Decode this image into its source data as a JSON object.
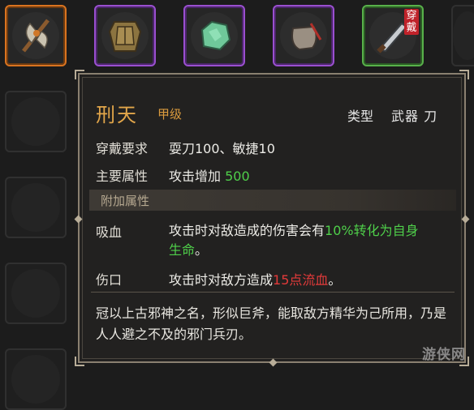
{
  "inventory": {
    "worn_tag": "穿戴",
    "slots_top": [
      {
        "name": "axe",
        "rarity": "orange"
      },
      {
        "name": "armor",
        "rarity": "purple"
      },
      {
        "name": "jade",
        "rarity": "purple"
      },
      {
        "name": "pouch",
        "rarity": "purple"
      },
      {
        "name": "blade",
        "rarity": "green",
        "worn": true
      }
    ]
  },
  "tooltip": {
    "name": "刑天",
    "grade": "甲级",
    "type_label": "类型",
    "type_value": "武器 刀",
    "requirement_label": "穿戴要求",
    "requirement_value": "耍刀100、敏捷10",
    "main_attr_label": "主要属性",
    "main_attr_text": "攻击增加",
    "main_attr_value": "500",
    "extra_section": "附加属性",
    "lifesteal_label": "吸血",
    "lifesteal_text_1": "攻击时对敌造成的伤害会有",
    "lifesteal_highlight_1": "10%转化为自身",
    "lifesteal_highlight_2": "生命",
    "lifesteal_end": "。",
    "wound_label": "伤口",
    "wound_text": "攻击时对敌方造成",
    "wound_highlight": "15点流血",
    "wound_end": "。",
    "description": "冠以上古邪神之名，形似巨斧，能取敌方精华为己所用，乃是人人避之不及的邪门兵刃。"
  },
  "watermark": "游侠网",
  "colors": {
    "title": "#e2a64a",
    "positive": "#4fcf4a",
    "negative": "#e23a3a",
    "legendary_border": "#d9731f",
    "epic_border": "#9a4fd0",
    "uncommon_border": "#58b04a"
  }
}
